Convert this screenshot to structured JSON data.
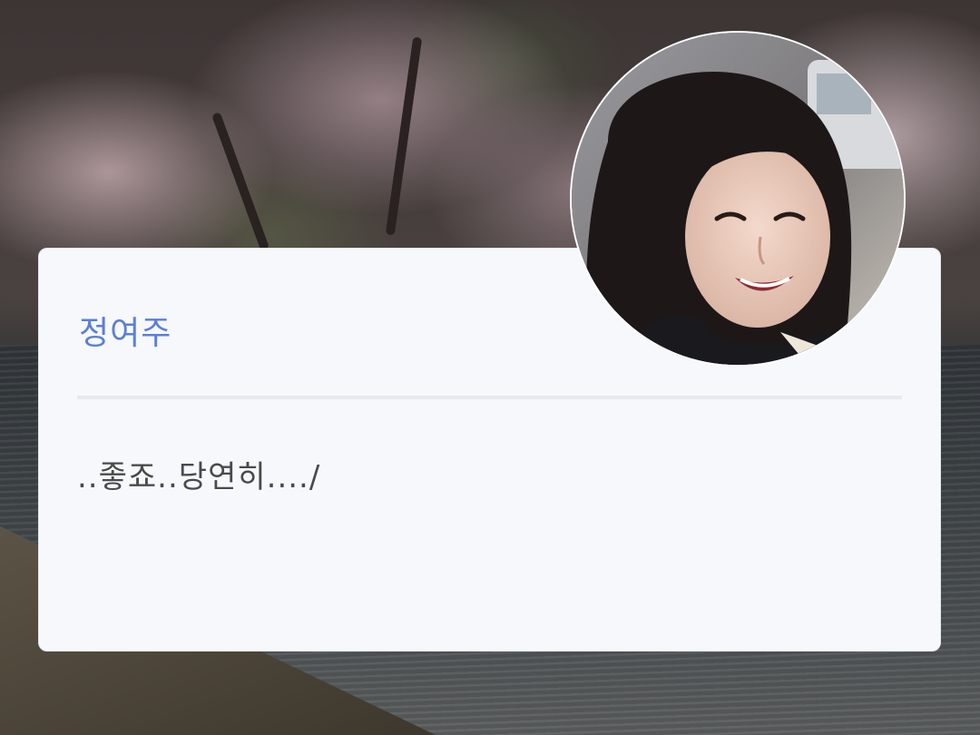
{
  "profile": {
    "name": "정여주",
    "message": "..좋죠..당연히..../",
    "avatar_label": "profile photo"
  },
  "colors": {
    "name_accent": "#5b7fd6",
    "card_background": "#f6f8fb",
    "message_text": "#4a4a4a"
  }
}
